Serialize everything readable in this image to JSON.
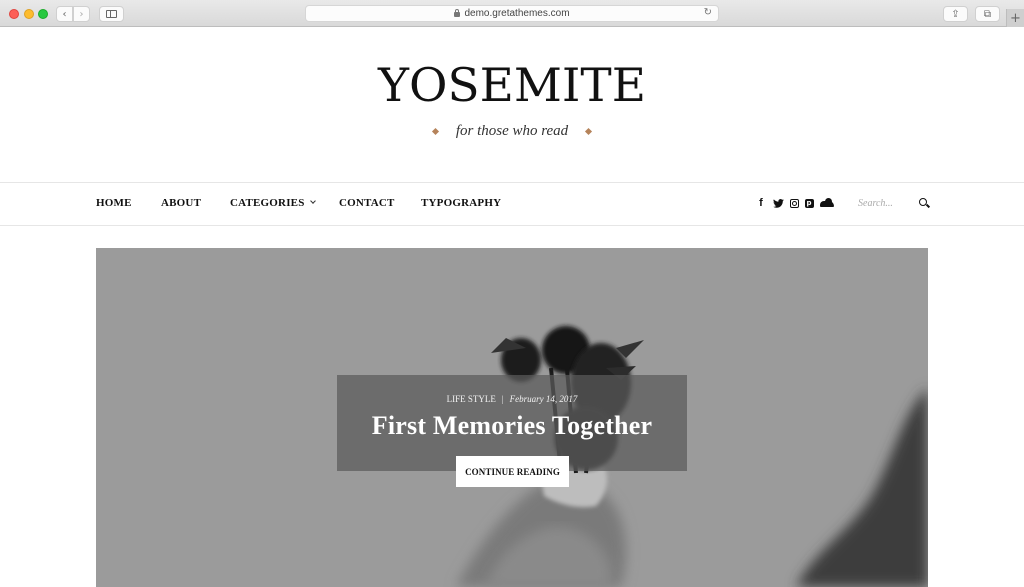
{
  "browser": {
    "url": "demo.gretathemes.com",
    "back_glyph": "‹",
    "forward_glyph": "›",
    "reload_glyph": "↻",
    "share_glyph": "⇪",
    "tabs_glyph": "⧉",
    "newtab_glyph": "+"
  },
  "site": {
    "title": "YOSEMITE",
    "tagline": "for those who read",
    "accent_color": "#b5835a"
  },
  "nav": {
    "items": [
      {
        "label": "HOME"
      },
      {
        "label": "ABOUT"
      },
      {
        "label": "CATEGORIES",
        "has_dropdown": true
      },
      {
        "label": "CONTACT"
      },
      {
        "label": "TYPOGRAPHY"
      }
    ],
    "social": {
      "facebook": "f",
      "twitter": "🐦",
      "pinterest": "p"
    },
    "search_placeholder": "Search..."
  },
  "hero": {
    "category": "LIFE STYLE",
    "separator": "|",
    "date": "February 14, 2017",
    "title": "First Memories Together",
    "cta_label": "CONTINUE READING"
  }
}
